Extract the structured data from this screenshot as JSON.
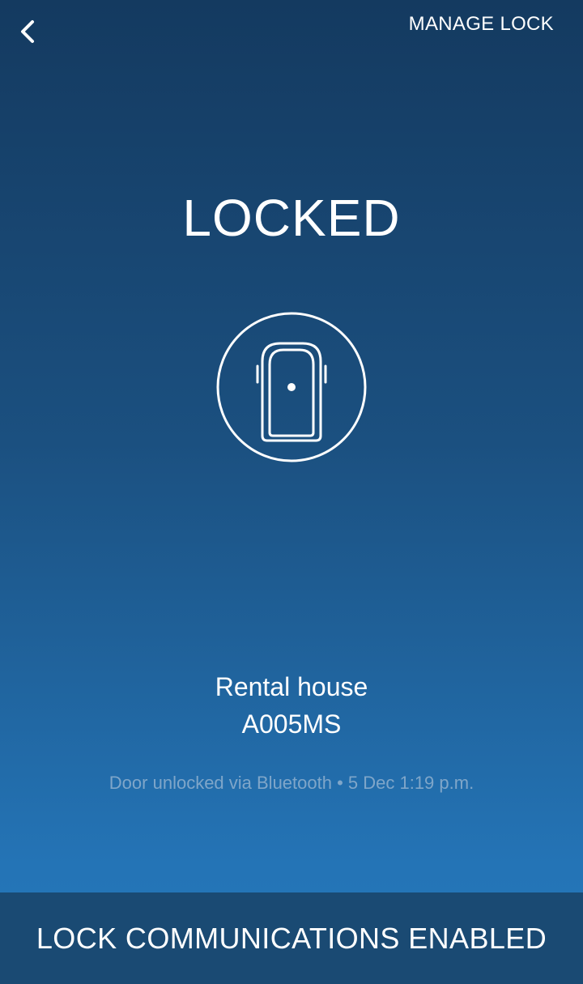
{
  "header": {
    "back_icon": "chevron-left-icon",
    "manage_label": "MANAGE LOCK"
  },
  "status": {
    "title": "LOCKED",
    "icon": "door-icon"
  },
  "lock": {
    "name": "Rental house",
    "id": "A005MS"
  },
  "activity": {
    "text": "Door unlocked via Bluetooth • 5 Dec 1:19 p.m."
  },
  "banner": {
    "text": "LOCK COMMUNICATIONS ENABLED"
  },
  "colors": {
    "background_top": "#143a60",
    "background_bottom": "#2678bb",
    "banner": "#1a4a73",
    "activity_text": "#7fa6c9"
  }
}
